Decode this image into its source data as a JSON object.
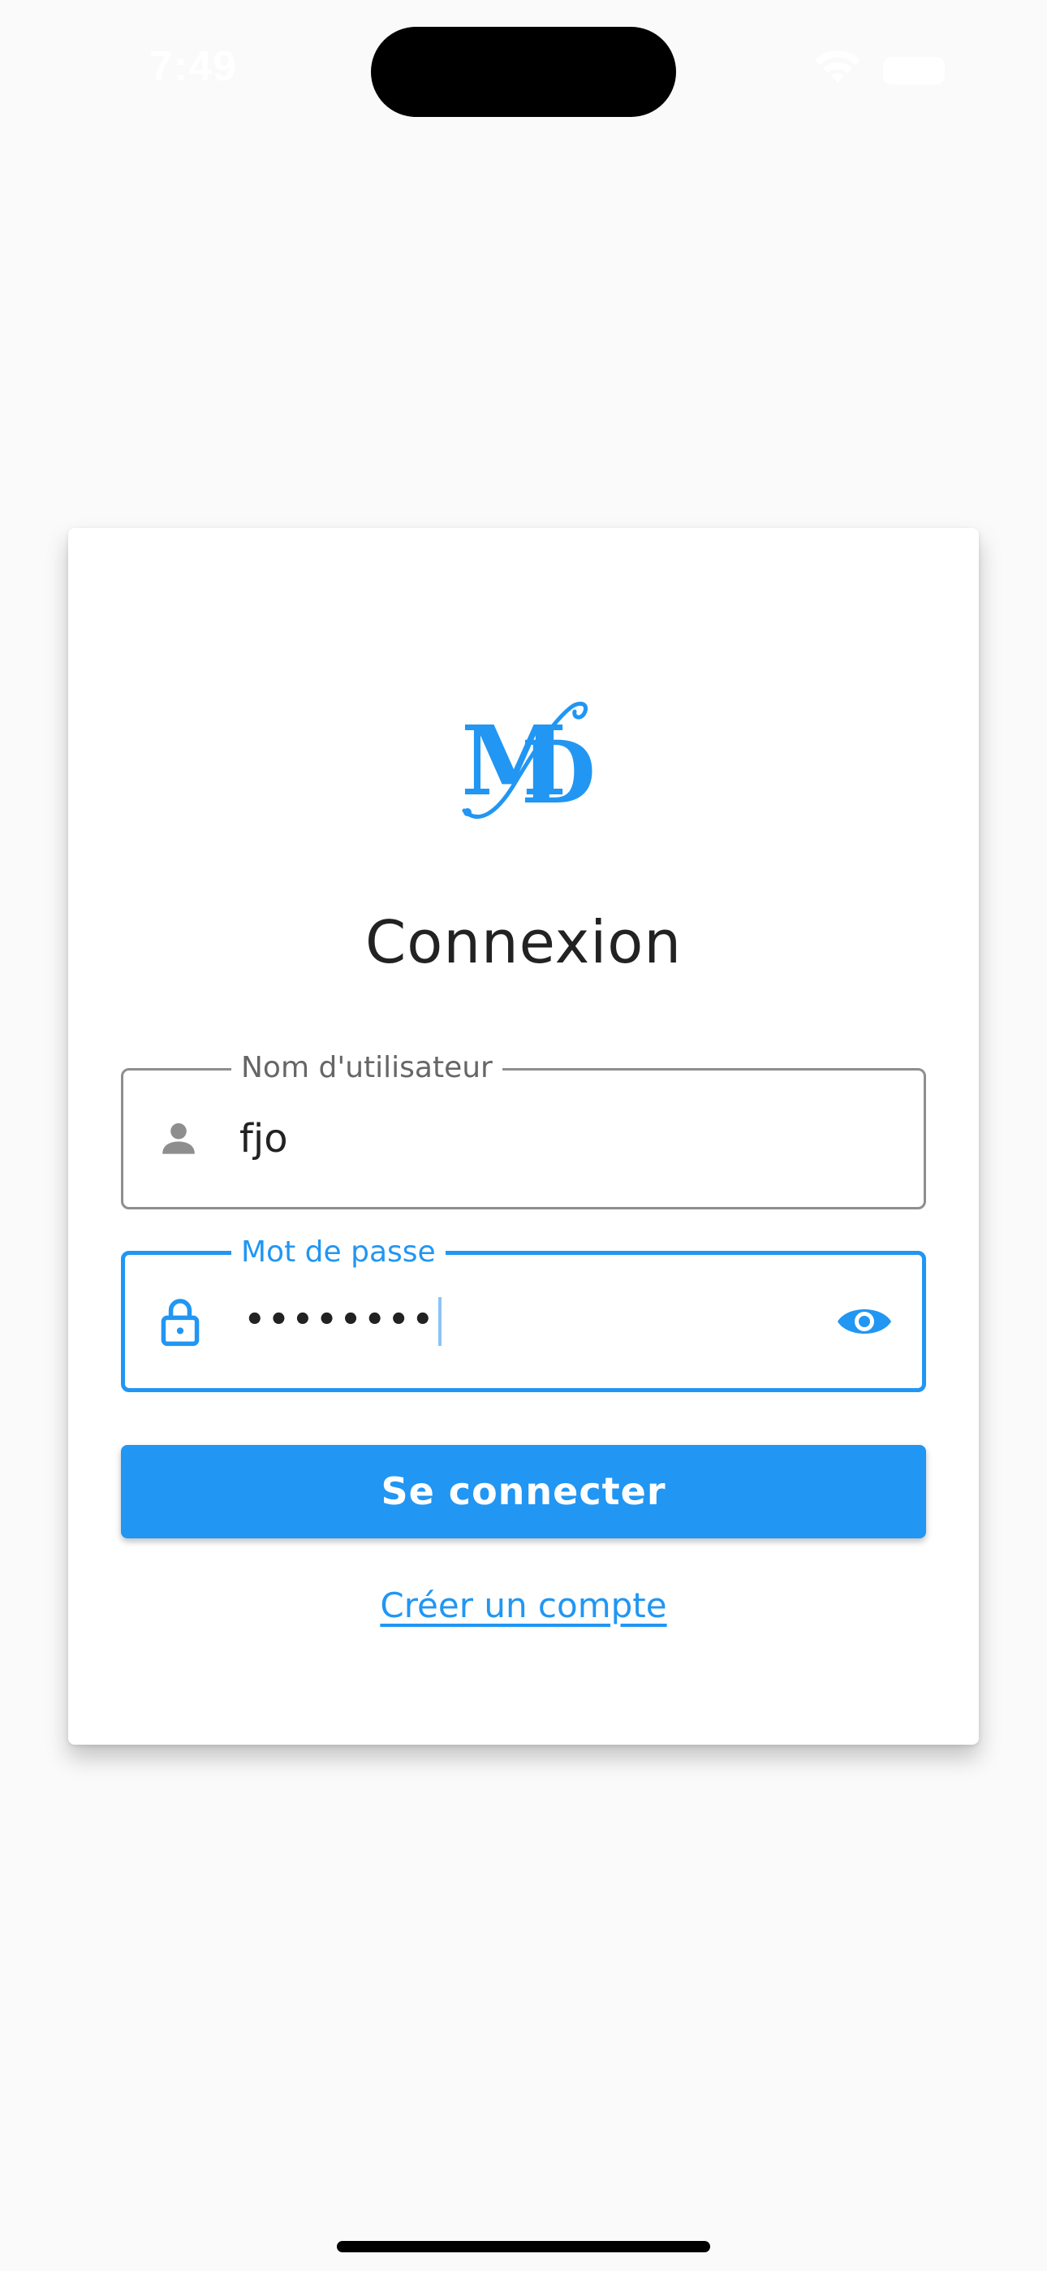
{
  "status_bar": {
    "time": "7:49"
  },
  "logo": {
    "text": "MD",
    "color": "#2196f3"
  },
  "login": {
    "title": "Connexion",
    "username": {
      "label": "Nom d'utilisateur",
      "value": "fjo",
      "icon": "person-icon"
    },
    "password": {
      "label": "Mot de passe",
      "value": "••••••••",
      "icon": "lock-icon",
      "toggle_icon": "eye-icon"
    },
    "submit_label": "Se connecter",
    "create_account_label": "Créer un compte"
  },
  "colors": {
    "accent": "#2196f3",
    "background": "#fafafa",
    "card": "#ffffff"
  }
}
